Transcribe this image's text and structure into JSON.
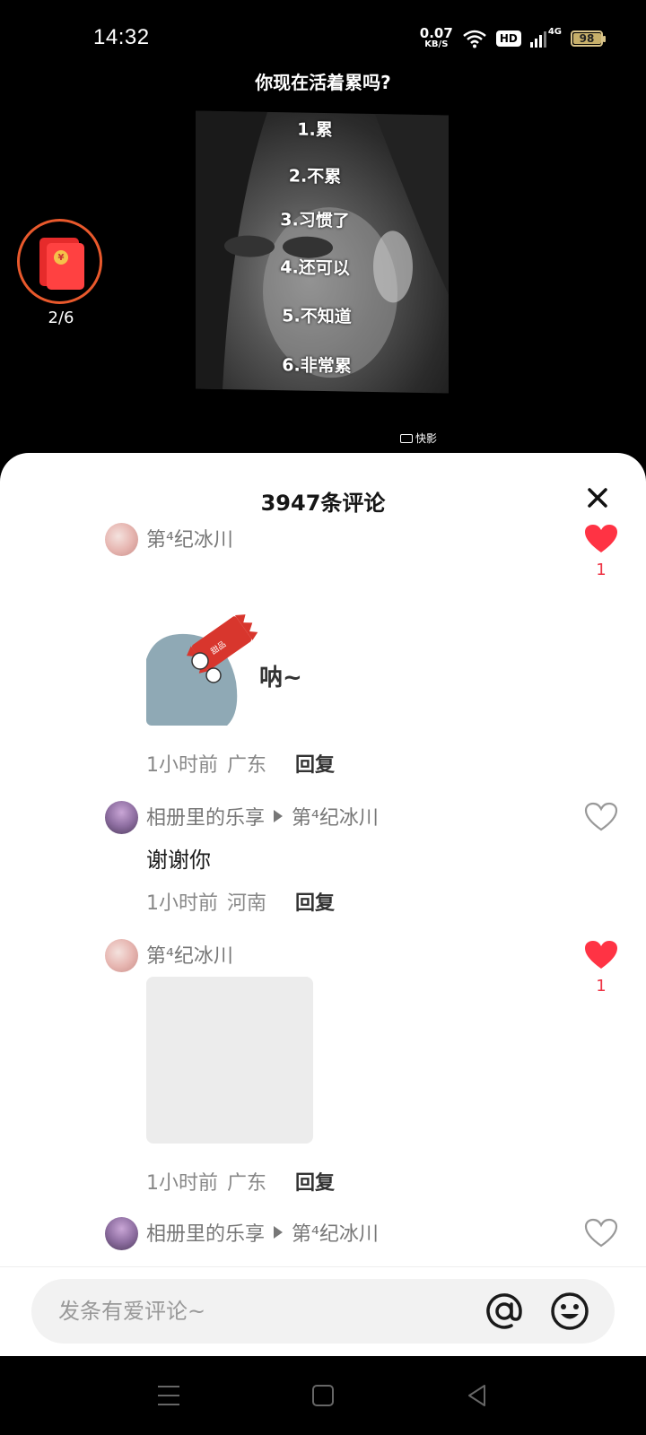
{
  "status_bar": {
    "time": "14:32",
    "net_speed_value": "0.07",
    "net_speed_unit": "KB/S",
    "hd": "HD",
    "network": "4G",
    "battery": "98"
  },
  "video": {
    "title": "你现在活着累吗?",
    "options": [
      "1.累",
      "2.不累",
      "3.习惯了",
      "4.还可以",
      "5.不知道",
      "6.非常累"
    ],
    "watermark": "快影"
  },
  "red_packet": {
    "progress": "2/6",
    "coin_symbol": "¥"
  },
  "comments_panel": {
    "title": "3947条评论",
    "close_icon": "close-icon"
  },
  "comments": [
    {
      "user": "第⁴纪冰川",
      "sticker_text": "呐~",
      "time": "1小时前",
      "location": "广东",
      "reply_label": "回复",
      "liked": true,
      "like_count": "1"
    },
    {
      "user": "相册里的乐享",
      "reply_to": "第⁴纪冰川",
      "text": "谢谢你",
      "time": "1小时前",
      "location": "河南",
      "reply_label": "回复",
      "liked": false
    },
    {
      "user": "第⁴纪冰川",
      "time": "1小时前",
      "location": "广东",
      "reply_label": "回复",
      "liked": true,
      "like_count": "1"
    },
    {
      "user": "相册里的乐享",
      "reply_to": "第⁴纪冰川",
      "liked": false
    }
  ],
  "input": {
    "placeholder": "发条有爱评论~"
  },
  "colors": {
    "like_red": "#ee3344",
    "packet_ring": "#e9592c"
  }
}
